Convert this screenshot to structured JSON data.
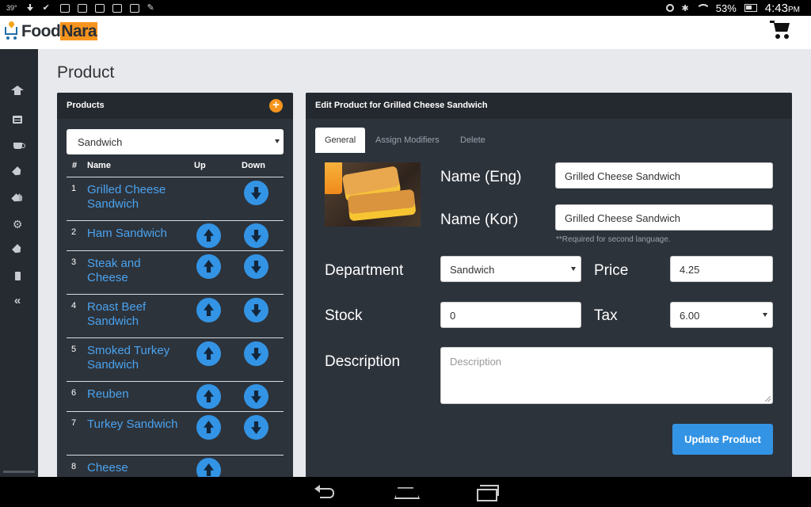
{
  "status_bar": {
    "temperature": "39°",
    "battery_percent": "53%",
    "time": "4:43",
    "time_suffix": "PM",
    "icons": [
      "download-icon",
      "check-icon",
      "youtube-icon",
      "image-icon",
      "screenshot-icon",
      "gallery-icon",
      "no-sim-icon",
      "wrench-icon",
      "location-icon",
      "bluetooth-icon",
      "wifi-icon",
      "battery-icon"
    ]
  },
  "app": {
    "logo_part1": "Food",
    "logo_part2": "Nara",
    "cart_icon": "shopping-cart-icon"
  },
  "nav": {
    "items": [
      "home-icon",
      "list-icon",
      "coffee-icon",
      "tag-icon",
      "tags-icon",
      "gear-icon",
      "tag-icon",
      "mobile-icon",
      "collapse-icon"
    ]
  },
  "page": {
    "title": "Product"
  },
  "products_panel": {
    "title": "Products",
    "category_value": "Sandwich",
    "columns": {
      "num": "#",
      "name": "Name",
      "up": "Up",
      "down": "Down"
    },
    "rows": [
      {
        "num": "1",
        "name": "Grilled Cheese Sandwich"
      },
      {
        "num": "2",
        "name": "Ham Sandwich"
      },
      {
        "num": "3",
        "name": "Steak and Cheese"
      },
      {
        "num": "4",
        "name": "Roast Beef Sandwich"
      },
      {
        "num": "5",
        "name": "Smoked Turkey Sandwich"
      },
      {
        "num": "6",
        "name": "Reuben"
      },
      {
        "num": "7",
        "name": "Turkey Sandwich"
      },
      {
        "num": "8",
        "name": "Cheese"
      }
    ]
  },
  "edit_panel": {
    "title": "Edit Product for Grilled Cheese Sandwich",
    "tabs": [
      "General",
      "Assign Modifiers",
      "Delete"
    ],
    "labels": {
      "name_eng": "Name (Eng)",
      "name_kor": "Name (Kor)",
      "department": "Department",
      "price": "Price",
      "stock": "Stock",
      "tax": "Tax",
      "description": "Description"
    },
    "values": {
      "name_eng": "Grilled Cheese Sandwich",
      "name_kor": "Grilled Cheese Sandwich",
      "department": "Sandwich",
      "price": "4.25",
      "stock": "0",
      "tax": "6.00",
      "description": ""
    },
    "placeholders": {
      "description": "Description"
    },
    "note": "**Required for second language.",
    "update_label": "Update Product"
  },
  "colors": {
    "accent": "#3394e5",
    "brand_orange": "#f7941d",
    "panel_bg": "#2d333b",
    "link_blue": "#4aa3ef"
  }
}
